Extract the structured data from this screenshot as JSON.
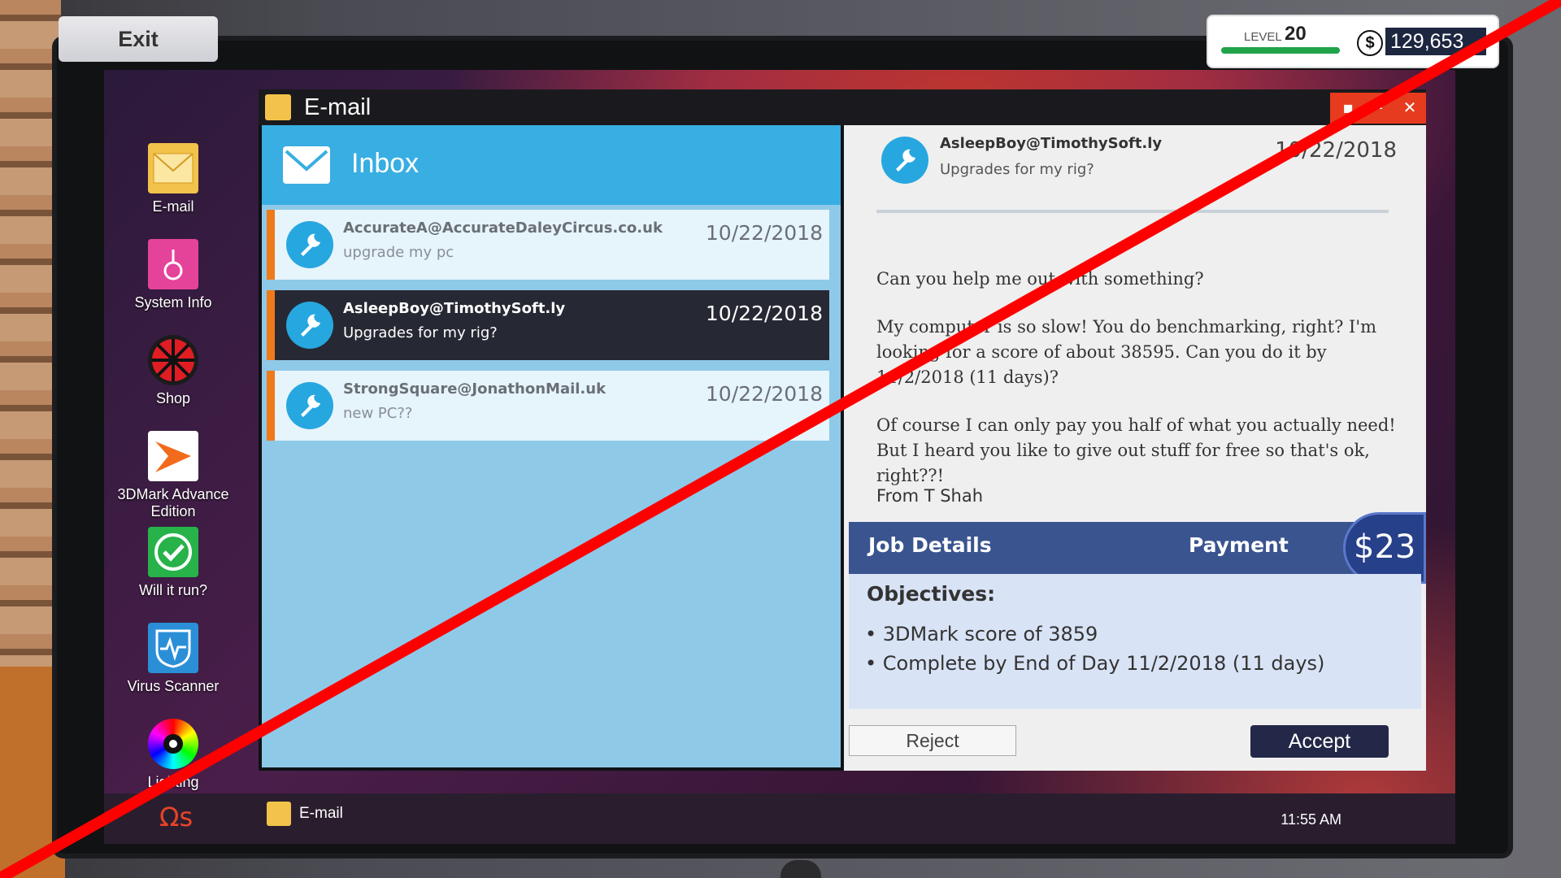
{
  "top": {
    "exit_label": "Exit",
    "level_label": "LEVEL",
    "level_value": "20",
    "level_progress": 1.0,
    "currency_symbol": "$",
    "money": "129,653"
  },
  "desktop": {
    "icons": [
      {
        "label": "E-mail",
        "icon": "email-icon"
      },
      {
        "label": "System Info",
        "icon": "system-info-icon"
      },
      {
        "label": "Shop",
        "icon": "shop-icon"
      },
      {
        "label": "3DMark Advance Edition",
        "icon": "3dmark-icon"
      },
      {
        "label": "Will it run?",
        "icon": "will-it-run-icon"
      },
      {
        "label": "Virus Scanner",
        "icon": "virus-scanner-icon"
      },
      {
        "label": "Lighting",
        "icon": "lighting-icon"
      }
    ]
  },
  "window": {
    "title": "E-mail",
    "controls": [
      "▪",
      "–",
      "✕"
    ]
  },
  "inbox": {
    "title": "Inbox",
    "items": [
      {
        "from": "AccurateA@AccurateDaleyCircus.co.uk",
        "subject": "upgrade my pc",
        "date": "10/22/2018",
        "selected": false
      },
      {
        "from": "AsleepBoy@TimothySoft.ly",
        "subject": "Upgrades for my rig?",
        "date": "10/22/2018",
        "selected": true
      },
      {
        "from": "StrongSquare@JonathonMail.uk",
        "subject": "new PC??",
        "date": "10/22/2018",
        "selected": false
      }
    ]
  },
  "message": {
    "from": "AsleepBoy@TimothySoft.ly",
    "subject": "Upgrades for my rig?",
    "date": "10/22/2018",
    "body": [
      "Can you help me out with something?",
      "My computer is so slow! You do benchmarking, right? I'm looking for a score of about 38595. Can you do it by 11/2/2018 (11 days)?",
      "Of course I can only pay you half of what you actually need! But I heard you like to give out stuff for free so that's ok, right??!"
    ],
    "signature": "From T Shah"
  },
  "job": {
    "title": "Job Details",
    "payment_label": "Payment",
    "payment": "$23",
    "objectives_label": "Objectives:",
    "objectives": [
      "• 3DMark score of 3859",
      "• Complete by End of Day 11/2/2018 (11 days)"
    ]
  },
  "actions": {
    "reject": "Reject",
    "accept": "Accept"
  },
  "taskbar": {
    "start_logo": "Ωs",
    "app_label": "E-mail",
    "clock": "11:55 AM"
  },
  "colors": {
    "inbox_header": "#38aee2",
    "accent_orange": "#ee7a1a",
    "job_header": "#3a5490",
    "strike_red": "#ff0000"
  }
}
